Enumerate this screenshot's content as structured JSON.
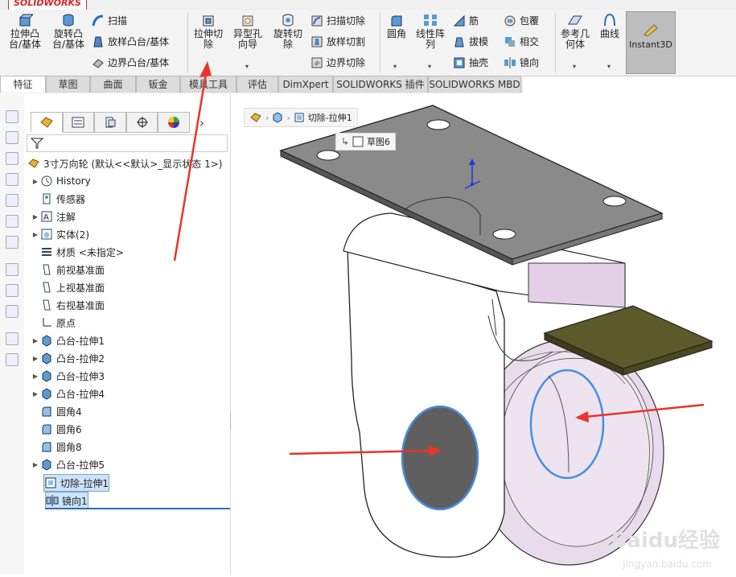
{
  "app": {
    "brand": "SOLIDWORKS"
  },
  "ribbon": {
    "extrude_boss": "拉伸凸台/基体",
    "revolve_boss": "旋转凸台/基体",
    "sweep": "扫描",
    "loft_boss": "放样凸台/基体",
    "boundary_boss": "边界凸台/基体",
    "extrude_cut": "拉伸切除",
    "hole_wizard": "异型孔向导",
    "revolve_cut": "旋转切除",
    "sweep_cut": "扫描切除",
    "loft_cut": "放样切割",
    "boundary_cut": "边界切除",
    "fillet": "圆角",
    "linear_pattern": "线性阵列",
    "rib": "筋",
    "draft": "拔模",
    "shell": "抽壳",
    "wrap": "包覆",
    "intersect": "相交",
    "mirror": "镜向",
    "ref_geometry": "参考几何体",
    "curves": "曲线",
    "instant3d": "Instant3D"
  },
  "tabs": [
    "特征",
    "草图",
    "曲面",
    "钣金",
    "模具工具",
    "评估",
    "DimXpert",
    "SOLIDWORKS 插件",
    "SOLIDWORKS MBD"
  ],
  "tree": {
    "root": "3寸万向轮  (默认<<默认>_显示状态 1>)",
    "items": [
      {
        "label": "History",
        "expand": true,
        "icon": "history-icon"
      },
      {
        "label": "传感器",
        "expand": false,
        "icon": "sensor-icon"
      },
      {
        "label": "注解",
        "expand": true,
        "icon": "annotation-icon"
      },
      {
        "label": "实体(2)",
        "expand": true,
        "icon": "solid-bodies-icon"
      },
      {
        "label": "材质 <未指定>",
        "expand": false,
        "icon": "material-icon"
      },
      {
        "label": "前视基准面",
        "expand": false,
        "icon": "plane-icon"
      },
      {
        "label": "上视基准面",
        "expand": false,
        "icon": "plane-icon"
      },
      {
        "label": "右视基准面",
        "expand": false,
        "icon": "plane-icon"
      },
      {
        "label": "原点",
        "expand": false,
        "icon": "origin-icon"
      },
      {
        "label": "凸台-拉伸1",
        "expand": true,
        "icon": "boss-extrude-icon"
      },
      {
        "label": "凸台-拉伸2",
        "expand": true,
        "icon": "boss-extrude-icon"
      },
      {
        "label": "凸台-拉伸3",
        "expand": true,
        "icon": "boss-extrude-icon"
      },
      {
        "label": "凸台-拉伸4",
        "expand": true,
        "icon": "boss-extrude-icon"
      },
      {
        "label": "圆角4",
        "expand": false,
        "icon": "fillet-icon"
      },
      {
        "label": "圆角6",
        "expand": false,
        "icon": "fillet-icon"
      },
      {
        "label": "圆角8",
        "expand": false,
        "icon": "fillet-icon"
      },
      {
        "label": "凸台-拉伸5",
        "expand": true,
        "icon": "boss-extrude-icon"
      },
      {
        "label": "切除-拉伸1",
        "expand": true,
        "icon": "cut-extrude-icon",
        "selected": true
      },
      {
        "label": "镜向1",
        "expand": false,
        "icon": "mirror-icon",
        "selected": true
      }
    ]
  },
  "viewport": {
    "breadcrumb_feature": "切除-拉伸1",
    "breadcrumb_sketch": "草图6",
    "watermark": "Baidu经验",
    "watermark_sub": "jingyan.baidu.com"
  }
}
